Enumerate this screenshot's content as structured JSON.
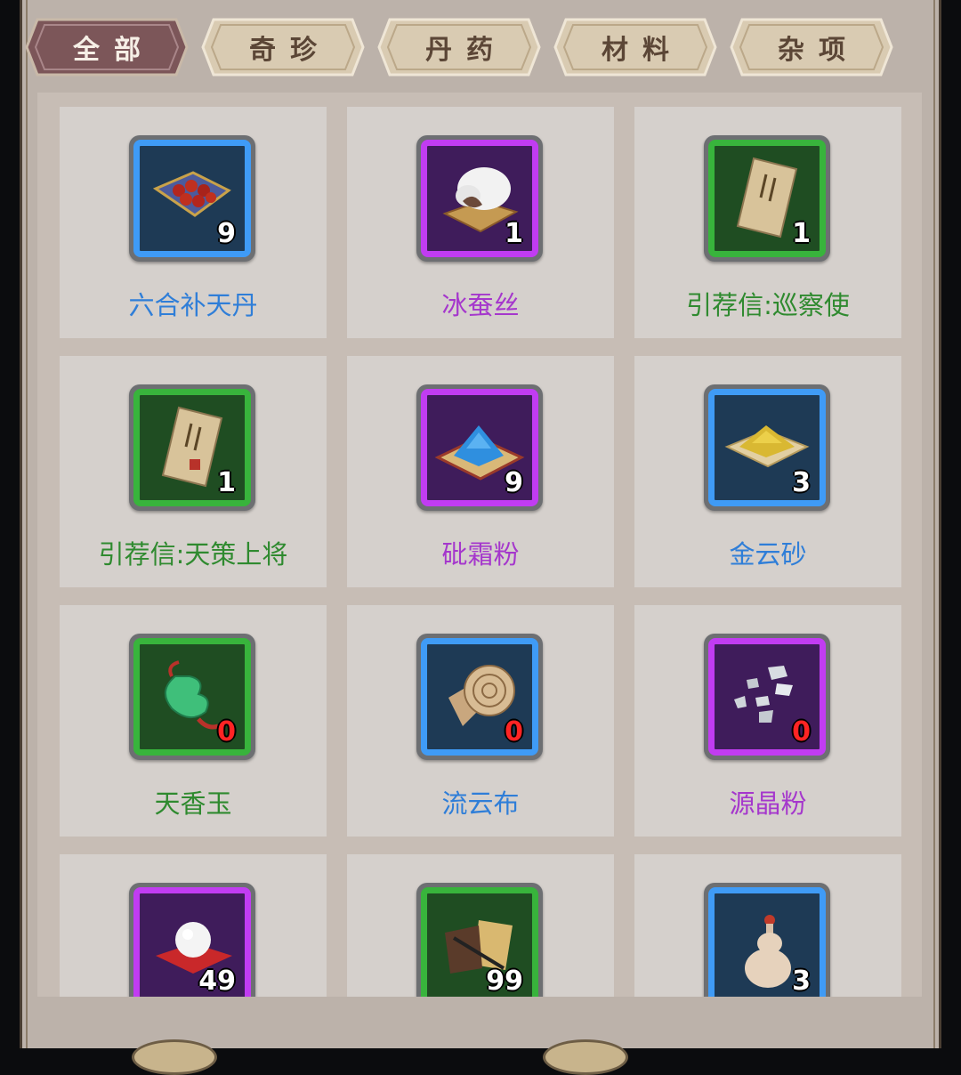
{
  "tabs": [
    {
      "label": "全部",
      "active": true
    },
    {
      "label": "奇珍",
      "active": false
    },
    {
      "label": "丹药",
      "active": false
    },
    {
      "label": "材料",
      "active": false
    },
    {
      "label": "杂项",
      "active": false
    }
  ],
  "items": [
    {
      "name": "六合补天丹",
      "count": "9",
      "quality": "blue",
      "icon": "red-pills-on-cloth-icon"
    },
    {
      "name": "冰蚕丝",
      "count": "1",
      "quality": "purple",
      "icon": "silk-cocoon-icon"
    },
    {
      "name": "引荐信:巡察使",
      "count": "1",
      "quality": "green",
      "icon": "letter-icon"
    },
    {
      "name": "引荐信:天策上将",
      "count": "1",
      "quality": "green",
      "icon": "letter-icon"
    },
    {
      "name": "砒霜粉",
      "count": "9",
      "quality": "purple",
      "icon": "blue-powder-icon"
    },
    {
      "name": "金云砂",
      "count": "3",
      "quality": "blue",
      "icon": "gold-sand-icon"
    },
    {
      "name": "天香玉",
      "count": "0",
      "quality": "green",
      "icon": "jade-pendant-icon"
    },
    {
      "name": "流云布",
      "count": "0",
      "quality": "blue",
      "icon": "cloth-roll-icon"
    },
    {
      "name": "源晶粉",
      "count": "0",
      "quality": "purple",
      "icon": "crystal-shards-icon"
    },
    {
      "name": "",
      "count": "49",
      "quality": "purple",
      "icon": "pearl-icon"
    },
    {
      "name": "",
      "count": "99",
      "quality": "green",
      "icon": "scroll-brush-icon"
    },
    {
      "name": "",
      "count": "3",
      "quality": "blue",
      "icon": "gourd-bottle-icon"
    }
  ],
  "colors": {
    "blue": "#3f9bf6",
    "purple": "#c13cf2",
    "green": "#38b43c",
    "zero_count": "#ff2424",
    "active_tab": "#7a5358"
  }
}
